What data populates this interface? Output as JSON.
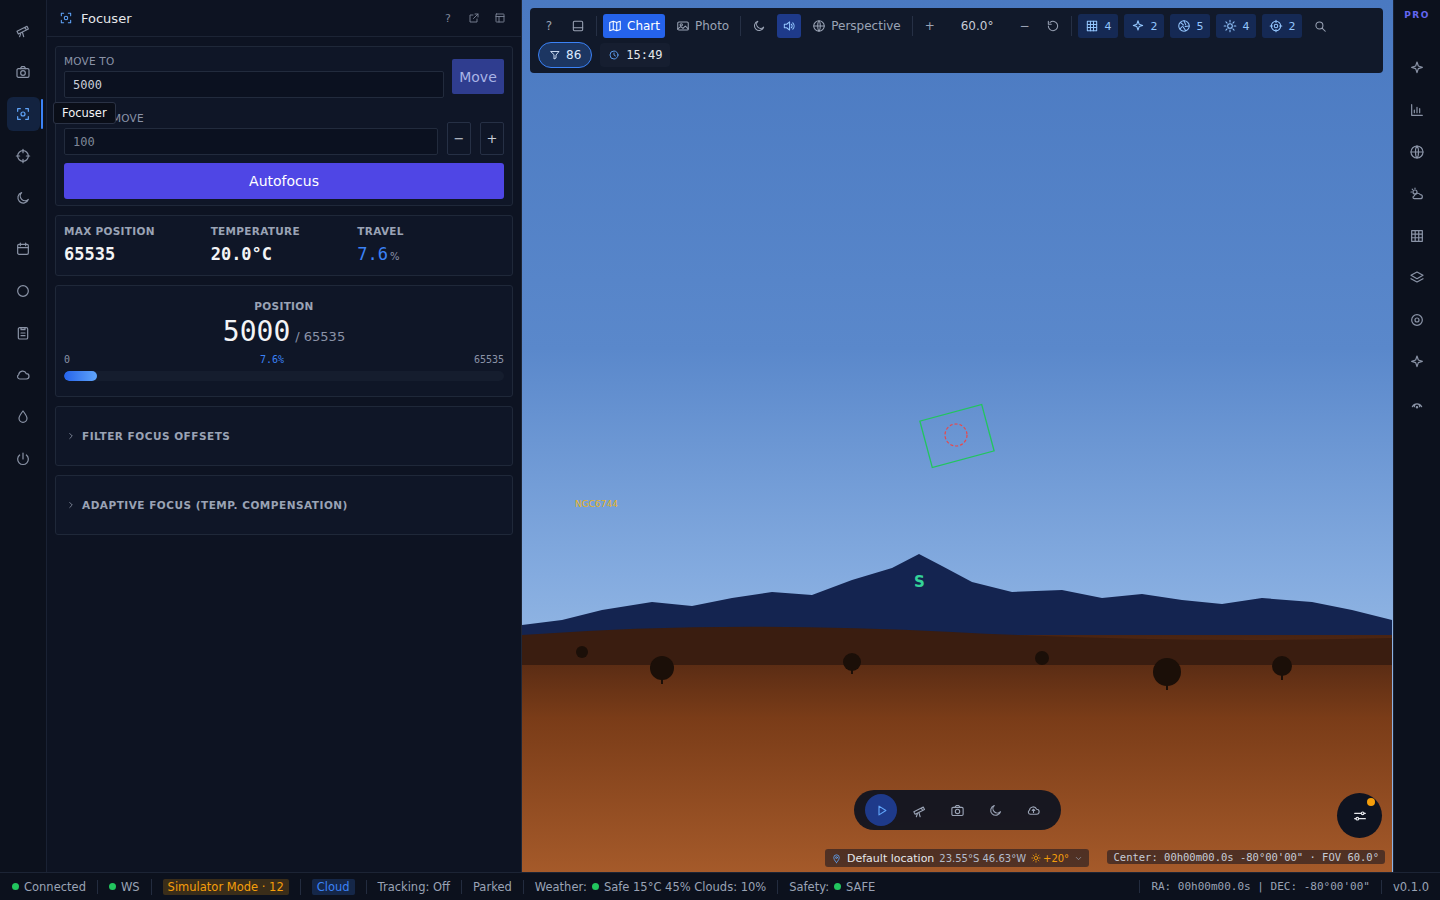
{
  "left_rail": {
    "items": [
      {
        "selected": false
      },
      {
        "selected": false
      },
      {
        "selected": true
      },
      {
        "selected": false
      },
      {
        "selected": false
      },
      {
        "selected": false
      },
      {
        "selected": false
      },
      {
        "selected": false
      },
      {
        "selected": false
      },
      {
        "selected": false
      },
      {
        "selected": false
      }
    ],
    "tooltip": "Focuser"
  },
  "panel": {
    "title": "Focuser",
    "help": "?"
  },
  "move": {
    "move_to_label": "MOVE TO",
    "move_to_value": "5000",
    "move_button": "Move",
    "relative_label": "MOVE",
    "relative_value": "100",
    "minus": "−",
    "plus": "+",
    "autofocus": "Autofocus"
  },
  "stats": [
    {
      "label": "MAX POSITION",
      "value": "65535",
      "unit": "",
      "accent": false
    },
    {
      "label": "TEMPERATURE",
      "value": "20.0°C",
      "unit": "",
      "accent": false
    },
    {
      "label": "TRAVEL",
      "value": "7.6",
      "unit": "%",
      "accent": true
    }
  ],
  "position": {
    "label": "POSITION",
    "value": "5000",
    "max": "/ 65535",
    "min_tick": "0",
    "percent": "7.6%",
    "max_tick": "65535",
    "level": 0.076
  },
  "sections": [
    {
      "label": "FILTER FOCUS OFFSETS",
      "expanded": false
    },
    {
      "label": "ADAPTIVE FOCUS (TEMP. COMPENSATION)",
      "expanded": false
    }
  ],
  "toolbar": {
    "items": [
      {
        "kind": "text",
        "text": "?"
      },
      {
        "kind": "icon",
        "active": false
      },
      {
        "kind": "tab",
        "text": "Chart",
        "selected": true
      },
      {
        "kind": "tab",
        "text": "Photo",
        "selected": false
      },
      {
        "kind": "icon",
        "active": false
      },
      {
        "kind": "icon",
        "active": true
      },
      {
        "kind": "label",
        "text": "Perspective"
      },
      {
        "kind": "text",
        "text": "+"
      },
      {
        "kind": "value",
        "text": "60.0°"
      },
      {
        "kind": "text",
        "text": "−"
      },
      {
        "kind": "icon",
        "active": false
      },
      {
        "kind": "count",
        "text": "4"
      },
      {
        "kind": "count",
        "text": "2"
      },
      {
        "kind": "count",
        "text": "5"
      },
      {
        "kind": "count",
        "text": "4"
      },
      {
        "kind": "count",
        "text": "2"
      },
      {
        "kind": "icon",
        "active": false
      }
    ],
    "filter_count": "86",
    "filter_active": true,
    "time": "15:49"
  },
  "sky": {
    "labels": [
      {
        "text": "NGC6744",
        "color": "#e6b422"
      },
      {
        "text": "S",
        "color": "#34d399"
      }
    ]
  },
  "controls": [
    {
      "selected": true
    },
    {
      "selected": false
    },
    {
      "selected": false
    },
    {
      "selected": false
    },
    {
      "selected": false
    }
  ],
  "location": {
    "name": "Default location",
    "coords": "23.55°S 46.63°W",
    "sun": "+20°"
  },
  "center": "Center: 00h00m00.0s -80°00'00\" · FOV 60.0°",
  "right_rail": {
    "badge": "PRO",
    "items": [
      {
        "selected": false
      },
      {
        "selected": false
      },
      {
        "selected": false
      },
      {
        "selected": false
      },
      {
        "selected": false
      },
      {
        "selected": false
      },
      {
        "selected": false
      },
      {
        "selected": false
      },
      {
        "selected": false
      }
    ]
  },
  "status_bar": {
    "left": [
      {
        "kind": "dot",
        "text": "Connected",
        "color": "#22c55e"
      },
      {
        "kind": "dot",
        "text": "WS",
        "color": "#22c55e"
      },
      {
        "kind": "badge",
        "text": "Simulator Mode · 12",
        "color": "#f59e0b"
      },
      {
        "kind": "badge",
        "text": "Cloud",
        "color": "#3b82f6"
      },
      {
        "kind": "text",
        "text": "Tracking: Off"
      },
      {
        "kind": "text",
        "text": "Parked"
      },
      {
        "kind": "labeled",
        "label": "Weather:",
        "text": "Safe 15°C 45% Clouds: 10%",
        "color": "#22c55e"
      },
      {
        "kind": "labeled",
        "label": "Safety:",
        "text": "SAFE",
        "color": "#22c55e"
      }
    ],
    "right": [
      "RA: 00h00m00.0s | DEC: -80°00'00\"",
      "v0.1.0"
    ]
  }
}
